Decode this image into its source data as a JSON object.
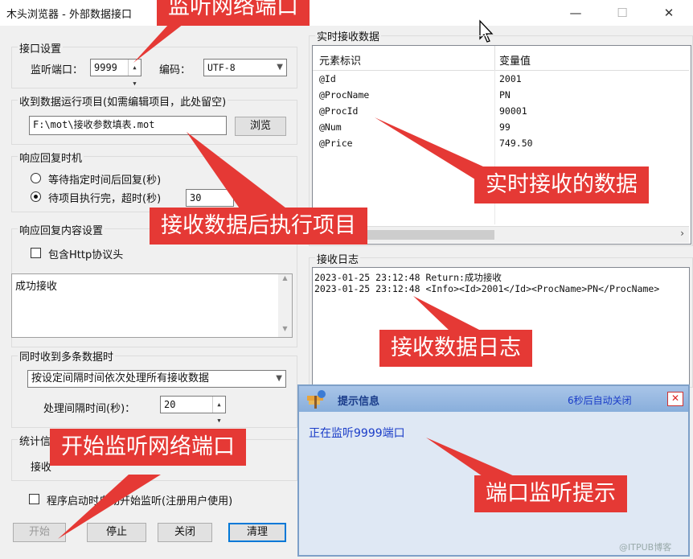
{
  "window": {
    "title": "木头浏览器 - 外部数据接口",
    "minimize": "—",
    "maximize": "☐",
    "close": "✕"
  },
  "port_settings": {
    "group_label": "接口设置",
    "port_label": "监听端口：",
    "port_value": "9999",
    "encoding_label": "编码：",
    "encoding_value": "UTF-8"
  },
  "run_project": {
    "group_label": "收到数据运行项目(如需编辑项目，此处留空)",
    "path_value": "F:\\mot\\接收参数填表.mot",
    "browse_label": "浏览"
  },
  "reply_timing": {
    "group_label": "响应回复时机",
    "option1": "等待指定时间后回复(秒)",
    "option2": "待项目执行完，超时(秒)",
    "timeout_value": "30"
  },
  "reply_content": {
    "group_label": "响应回复内容设置",
    "include_http_label": "包含Http协议头",
    "content_value": "成功接收"
  },
  "multi_data": {
    "group_label": "同时收到多条数据时",
    "mode_value": "按设定间隔时间依次处理所有接收数据",
    "interval_label": "处理间隔时间(秒)：",
    "interval_value": "20"
  },
  "stats": {
    "group_label": "统计信",
    "receive_label": "接收"
  },
  "autostart": {
    "label": "程序启动时自动开始监听(注册用户使用)"
  },
  "buttons": {
    "start": "开始",
    "stop": "停止",
    "close": "关闭",
    "clear": "清理"
  },
  "realtime": {
    "group_label": "实时接收数据",
    "col_name": "元素标识",
    "col_value": "变量值",
    "rows": [
      {
        "name": "@Id",
        "value": "2001"
      },
      {
        "name": "@ProcName",
        "value": "PN"
      },
      {
        "name": "@ProcId",
        "value": "90001"
      },
      {
        "name": "@Num",
        "value": "99"
      },
      {
        "name": "@Price",
        "value": "749.50"
      }
    ]
  },
  "log": {
    "group_label": "接收日志",
    "lines": [
      "2023-01-25 23:12:48 Return:成功接收",
      "2023-01-25 23:12:48 <Info><Id>2001</Id><ProcName>PN</ProcName>"
    ]
  },
  "popup": {
    "title": "提示信息",
    "autoclose": "6秒后自动关闭",
    "message": "正在监听9999端口"
  },
  "callouts": {
    "listen_port": "监听网络端口",
    "realtime_data": "实时接收的数据",
    "run_after_receive": "接收数据后执行项目",
    "receive_log": "接收数据日志",
    "start_listen": "开始监听网络端口",
    "port_tip": "端口监听提示"
  },
  "watermark": "@ITPUB博客",
  "colors": {
    "callout_bg": "#e53935",
    "popup_bg": "#dfe8f4",
    "popup_text": "#1a3cc8",
    "default_button_border": "#0078d7"
  }
}
